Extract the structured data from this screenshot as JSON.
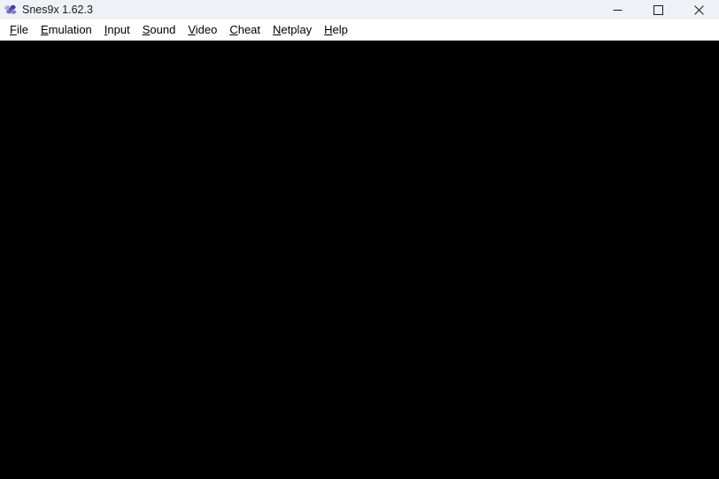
{
  "window": {
    "title": "Snes9x 1.62.3",
    "icon_name": "snes9x-logo-icon",
    "icon_colors": {
      "light_purple": "#b3a4e6",
      "mid_purple": "#8b79d4",
      "dark_purple": "#503a92"
    },
    "titlebar_background": "#eef2f6",
    "controls": [
      {
        "name": "minimize",
        "glyph": "minimize-icon",
        "tooltip": "Minimize"
      },
      {
        "name": "maximize",
        "glyph": "maximize-icon",
        "tooltip": "Maximize"
      },
      {
        "name": "close",
        "glyph": "close-icon",
        "tooltip": "Close"
      }
    ]
  },
  "menu": {
    "background": "#ffffff",
    "items": [
      {
        "label": "File",
        "accel": "F",
        "rest": "ile"
      },
      {
        "label": "Emulation",
        "accel": "E",
        "rest": "mulation"
      },
      {
        "label": "Input",
        "accel": "I",
        "rest": "nput"
      },
      {
        "label": "Sound",
        "accel": "S",
        "rest": "ound"
      },
      {
        "label": "Video",
        "accel": "V",
        "rest": "ideo"
      },
      {
        "label": "Cheat",
        "accel": "C",
        "rest": "heat"
      },
      {
        "label": "Netplay",
        "accel": "N",
        "rest": "etplay"
      },
      {
        "label": "Help",
        "accel": "H",
        "rest": "elp"
      }
    ]
  },
  "viewport": {
    "background": "#000000",
    "content": ""
  }
}
